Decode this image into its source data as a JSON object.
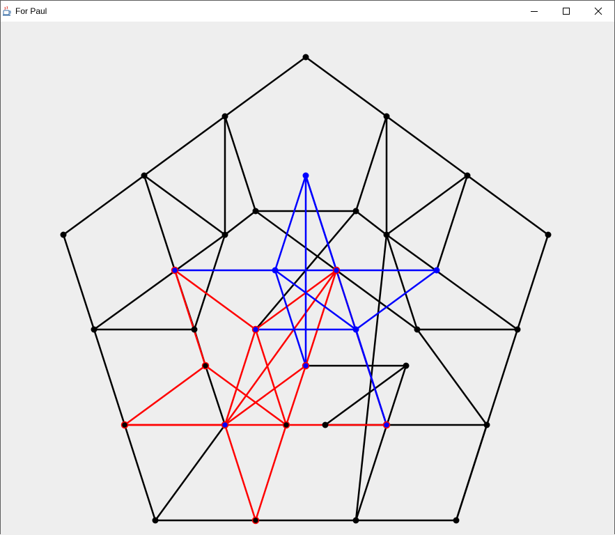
{
  "window": {
    "title": "For Paul",
    "app_icon": "java-cup-icon",
    "controls": [
      "minimize-icon",
      "maximize-icon",
      "close-icon"
    ]
  },
  "figure": {
    "colors": {
      "background": "#eeeeee",
      "black": "#000000",
      "red": "#ff0000",
      "blue": "#0000ff"
    }
  }
}
